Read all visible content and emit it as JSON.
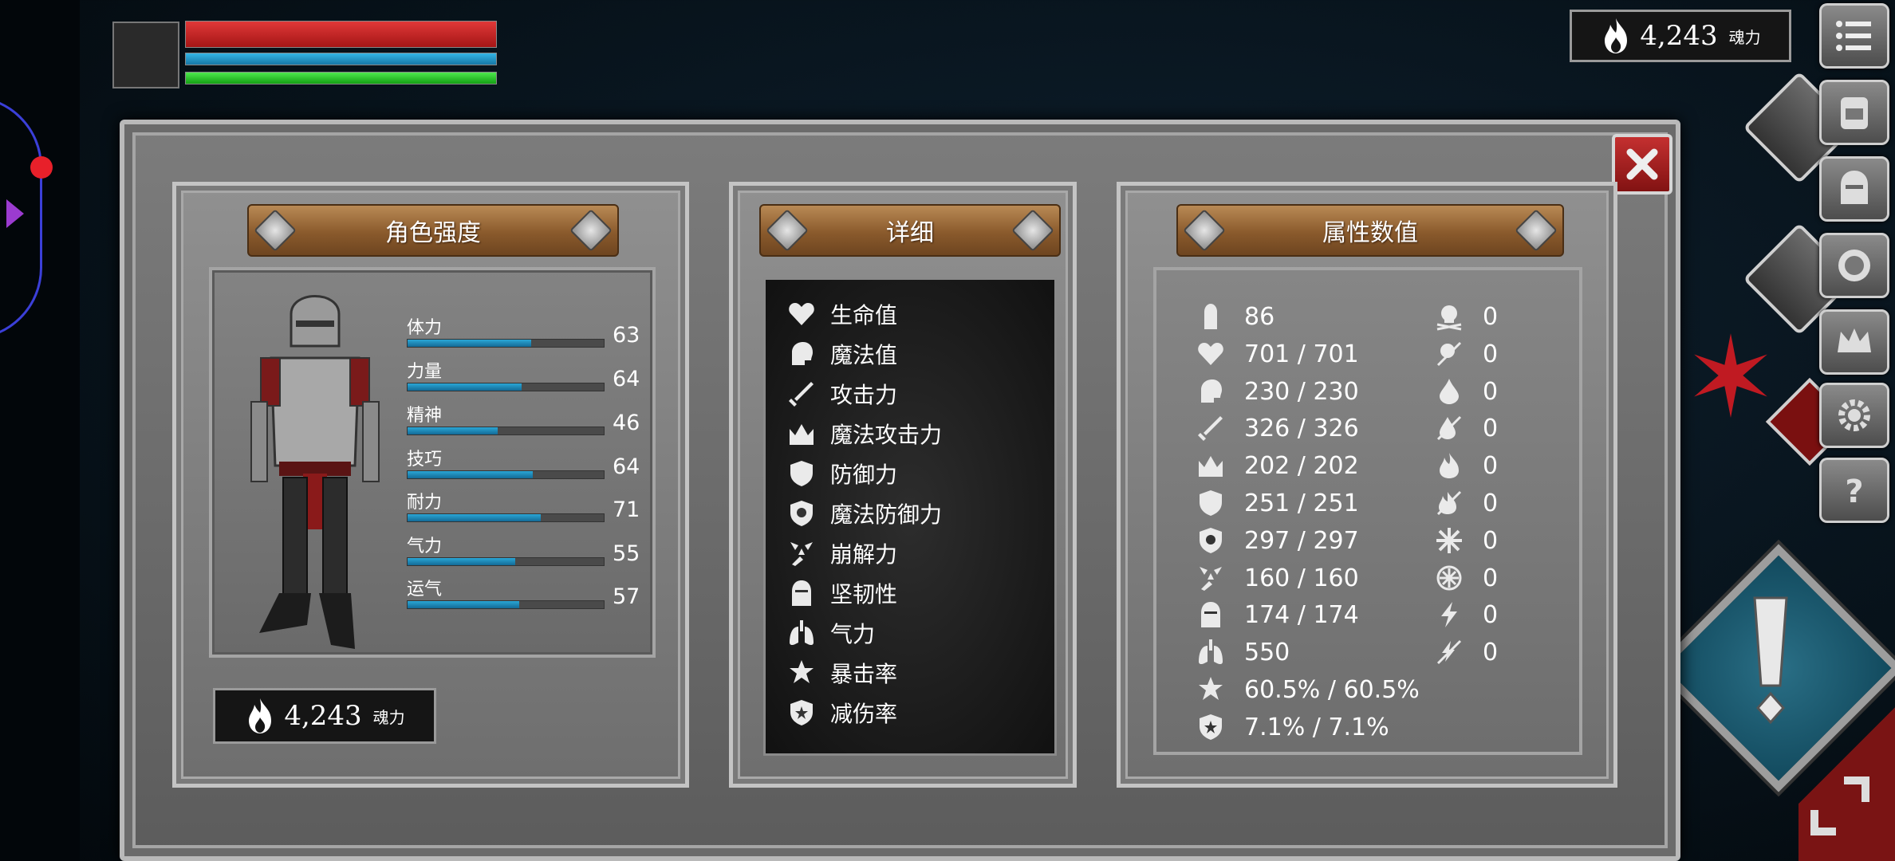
{
  "hud": {
    "currency_value": "4,243",
    "currency_unit": "魂力"
  },
  "panel_left": {
    "title": "角色强度",
    "stats": [
      {
        "label": "体力",
        "value": "63",
        "fill": 0.63
      },
      {
        "label": "力量",
        "value": "64",
        "fill": 0.58
      },
      {
        "label": "精神",
        "value": "46",
        "fill": 0.46
      },
      {
        "label": "技巧",
        "value": "64",
        "fill": 0.64
      },
      {
        "label": "耐力",
        "value": "71",
        "fill": 0.68
      },
      {
        "label": "气力",
        "value": "55",
        "fill": 0.55
      },
      {
        "label": "运气",
        "value": "57",
        "fill": 0.57
      }
    ],
    "currency_value": "4,243",
    "currency_unit": "魂力"
  },
  "panel_mid": {
    "title": "详细",
    "items": [
      {
        "label": "生命值",
        "icon": "heart-icon"
      },
      {
        "label": "魔法值",
        "icon": "head-icon"
      },
      {
        "label": "攻击力",
        "icon": "sword-icon"
      },
      {
        "label": "魔法攻击力",
        "icon": "magic-crown-icon"
      },
      {
        "label": "防御力",
        "icon": "shield-icon"
      },
      {
        "label": "魔法防御力",
        "icon": "magic-shield-icon"
      },
      {
        "label": "崩解力",
        "icon": "break-icon"
      },
      {
        "label": "坚韧性",
        "icon": "helmet-icon"
      },
      {
        "label": "气力",
        "icon": "lungs-icon"
      },
      {
        "label": "暴击率",
        "icon": "crit-star-icon"
      },
      {
        "label": "减伤率",
        "icon": "reduction-shield-icon"
      }
    ]
  },
  "panel_right": {
    "title": "属性数值",
    "left_column": [
      {
        "icon": "weight-icon",
        "value": "86"
      },
      {
        "icon": "heart-icon",
        "value": "701 / 701"
      },
      {
        "icon": "head-icon",
        "value": "230 / 230"
      },
      {
        "icon": "sword-icon",
        "value": "326 / 326"
      },
      {
        "icon": "magic-crown-icon",
        "value": "202 / 202"
      },
      {
        "icon": "shield-icon",
        "value": "251 / 251"
      },
      {
        "icon": "magic-shield-icon",
        "value": "297 / 297"
      },
      {
        "icon": "break-icon",
        "value": "160 / 160"
      },
      {
        "icon": "helmet-icon",
        "value": "174 / 174"
      },
      {
        "icon": "lungs-icon",
        "value": "550"
      },
      {
        "icon": "crit-star-icon",
        "value": "60.5% / 60.5%"
      },
      {
        "icon": "reduction-shield-icon",
        "value": "7.1% / 7.1%"
      }
    ],
    "right_column": [
      {
        "icon": "poison-skull-icon",
        "value": "0"
      },
      {
        "icon": "poison-resist-icon",
        "value": "0"
      },
      {
        "icon": "bleed-icon",
        "value": "0"
      },
      {
        "icon": "bleed-resist-icon",
        "value": "0"
      },
      {
        "icon": "fire-icon",
        "value": "0"
      },
      {
        "icon": "fire-resist-icon",
        "value": "0"
      },
      {
        "icon": "frost-icon",
        "value": "0"
      },
      {
        "icon": "frost-resist-icon",
        "value": "0"
      },
      {
        "icon": "lightning-icon",
        "value": "0"
      },
      {
        "icon": "lightning-resist-icon",
        "value": "0"
      }
    ]
  },
  "colors": {
    "hp": "#d02424",
    "mp": "#1f92c8",
    "stamina": "#22c422",
    "stat_fill": "#1f8fc0",
    "close_red": "#b02222"
  }
}
